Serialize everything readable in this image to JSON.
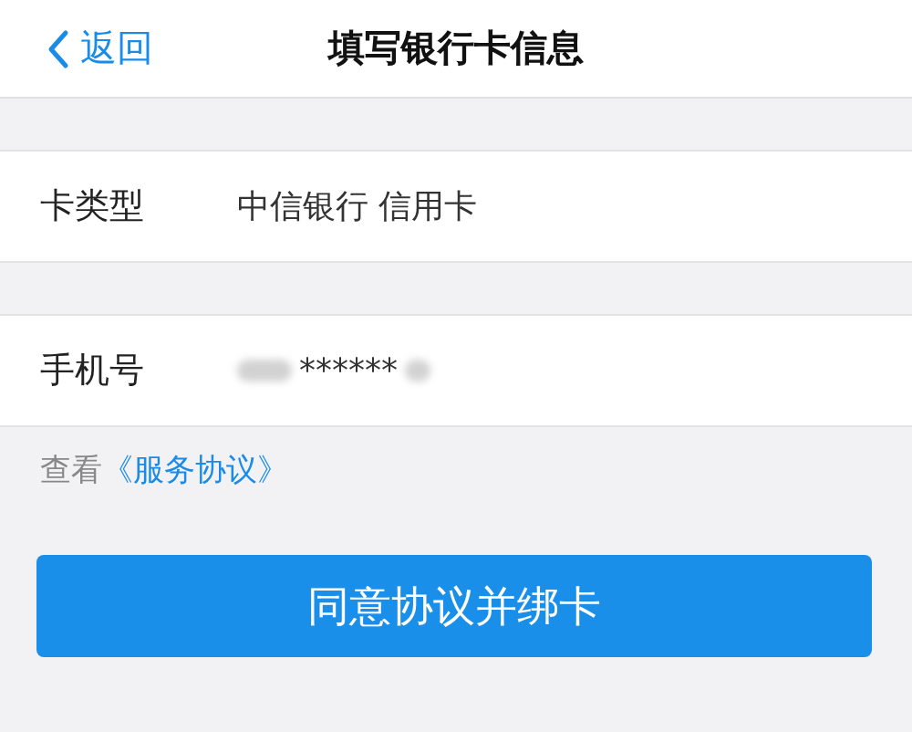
{
  "nav_bar": {
    "back": "返回",
    "title": "填写银行卡信息"
  },
  "fields": [
    {
      "label": "卡类型",
      "value": "中信银行 信用卡",
      "redacted": false
    },
    {
      "label": "手机号",
      "value": "******",
      "redacted": true
    }
  ],
  "agreement": {
    "prefix": "查看",
    "link": "《服务协议》"
  },
  "submit_button": "同意协议并绑卡"
}
